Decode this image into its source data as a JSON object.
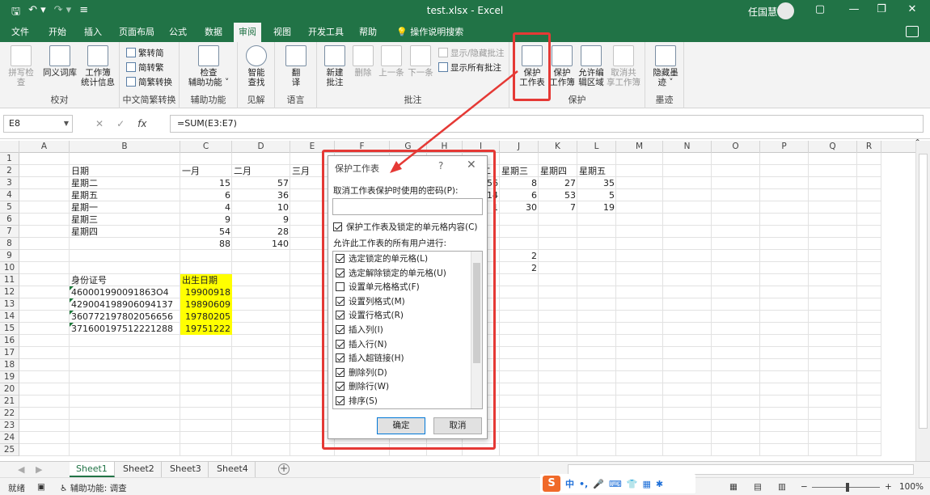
{
  "titlebar": {
    "title": "test.xlsx  -  Excel",
    "user": "任国慧",
    "controls": [
      "▢",
      "—",
      "❐",
      "✕"
    ]
  },
  "tabs": [
    "文件",
    "开始",
    "插入",
    "页面布局",
    "公式",
    "数据",
    "审阅",
    "视图",
    "开发工具",
    "帮助"
  ],
  "active_tab": "审阅",
  "tell_me": "操作说明搜索",
  "ribbon": {
    "groups": {
      "proofing": {
        "label": "校对",
        "buttons": [
          "拼写检查",
          "同义词库",
          "工作簿",
          "统计信息"
        ]
      },
      "chinese": {
        "label": "中文简繁转换",
        "items": [
          "繁转简",
          "简转繁",
          "简繁转换"
        ]
      },
      "accessibility": {
        "label": "辅助功能",
        "line1": "检查",
        "line2": "辅助功能 ˅"
      },
      "insights": {
        "label": "见解",
        "line1": "智能",
        "line2": "查找"
      },
      "language": {
        "label": "语言",
        "line1": "翻",
        "line2": "译"
      },
      "comments": {
        "label": "批注",
        "new1": "新建",
        "new2": "批注",
        "delete": "删除",
        "prev": "上一条",
        "next": "下一条",
        "show_hide": "显示/隐藏批注",
        "show_all": "显示所有批注"
      },
      "protect": {
        "label": "保护",
        "sheet1": "保护",
        "sheet2": "工作表",
        "wb1": "保护",
        "wb2": "工作簿",
        "ranges1": "允许编",
        "ranges2": "辑区域",
        "unshare1": "取消共",
        "unshare2": "享工作簿"
      },
      "ink": {
        "label": "墨迹",
        "line1": "隐藏墨",
        "line2": "迹 ˅"
      }
    }
  },
  "formula_bar": {
    "name_box": "E8",
    "formula": "=SUM(E3:E7)"
  },
  "grid": {
    "columns": [
      "A",
      "B",
      "C",
      "D",
      "E",
      "F",
      "G",
      "H",
      "I",
      "J",
      "K",
      "L",
      "M",
      "N",
      "O",
      "P",
      "Q",
      "R"
    ],
    "rows": [
      "1",
      "2",
      "3",
      "4",
      "5",
      "6",
      "7",
      "8",
      "9",
      "10",
      "11",
      "12",
      "13",
      "14",
      "15",
      "16",
      "17",
      "18",
      "19",
      "20",
      "21",
      "22",
      "23",
      "24",
      "25"
    ],
    "cells": {
      "B2": "日期",
      "C2": "一月",
      "D2": "二月",
      "E2": "三月",
      "I2": "星期二",
      "J2": "星期三",
      "K2": "星期四",
      "L2": "星期五",
      "B3": "星期二",
      "C3": "15",
      "D3": "57",
      "I3": "56",
      "J3": "8",
      "K3": "27",
      "L3": "35",
      "B4": "星期五",
      "C4": "6",
      "D4": "36",
      "I4": "14",
      "J4": "6",
      "K4": "53",
      "L4": "5",
      "B5": "星期一",
      "C5": "4",
      "D5": "10",
      "I5": "1",
      "J5": "30",
      "K5": "7",
      "L5": "19",
      "B6": "星期三",
      "C6": "9",
      "D6": "9",
      "B7": "星期四",
      "C7": "54",
      "D7": "28",
      "C8": "88",
      "D8": "140",
      "J9": "2",
      "J10": "2",
      "B11": "身份证号",
      "C11": "出生日期",
      "B12": "460001990091863O4",
      "C12": "19900918",
      "B13": "429004198906094137",
      "C13": "19890609",
      "B14": "360772197802056656",
      "C14": "19780205",
      "B15": "371600197512221288",
      "C15": "19751222"
    }
  },
  "sheets": [
    "Sheet1",
    "Sheet2",
    "Sheet3",
    "Sheet4"
  ],
  "active_sheet": "Sheet1",
  "status": {
    "ready": "就绪",
    "accessibility": "辅助功能: 调查",
    "zoom": "100%"
  },
  "ime": {
    "logo": "S",
    "mode": "中"
  },
  "dialog": {
    "title": "保护工作表",
    "help": "?",
    "close": "✕",
    "password_label": "取消工作表保护时使用的密码(P):",
    "protect_contents": "保护工作表及锁定的单元格内容(C)",
    "protect_contents_checked": true,
    "allow_label": "允许此工作表的所有用户进行:",
    "options": [
      {
        "label": "选定锁定的单元格(L)",
        "checked": true
      },
      {
        "label": "选定解除锁定的单元格(U)",
        "checked": true
      },
      {
        "label": "设置单元格格式(F)",
        "checked": false
      },
      {
        "label": "设置列格式(M)",
        "checked": true
      },
      {
        "label": "设置行格式(R)",
        "checked": true
      },
      {
        "label": "插入列(I)",
        "checked": true
      },
      {
        "label": "插入行(N)",
        "checked": true
      },
      {
        "label": "插入超链接(H)",
        "checked": true
      },
      {
        "label": "删除列(D)",
        "checked": true
      },
      {
        "label": "删除行(W)",
        "checked": true
      },
      {
        "label": "排序(S)",
        "checked": true
      }
    ],
    "ok": "确定",
    "cancel": "取消"
  },
  "colors": {
    "excel_green": "#217346",
    "annotation_red": "#e53935",
    "highlight_yellow": "#ffff00"
  }
}
